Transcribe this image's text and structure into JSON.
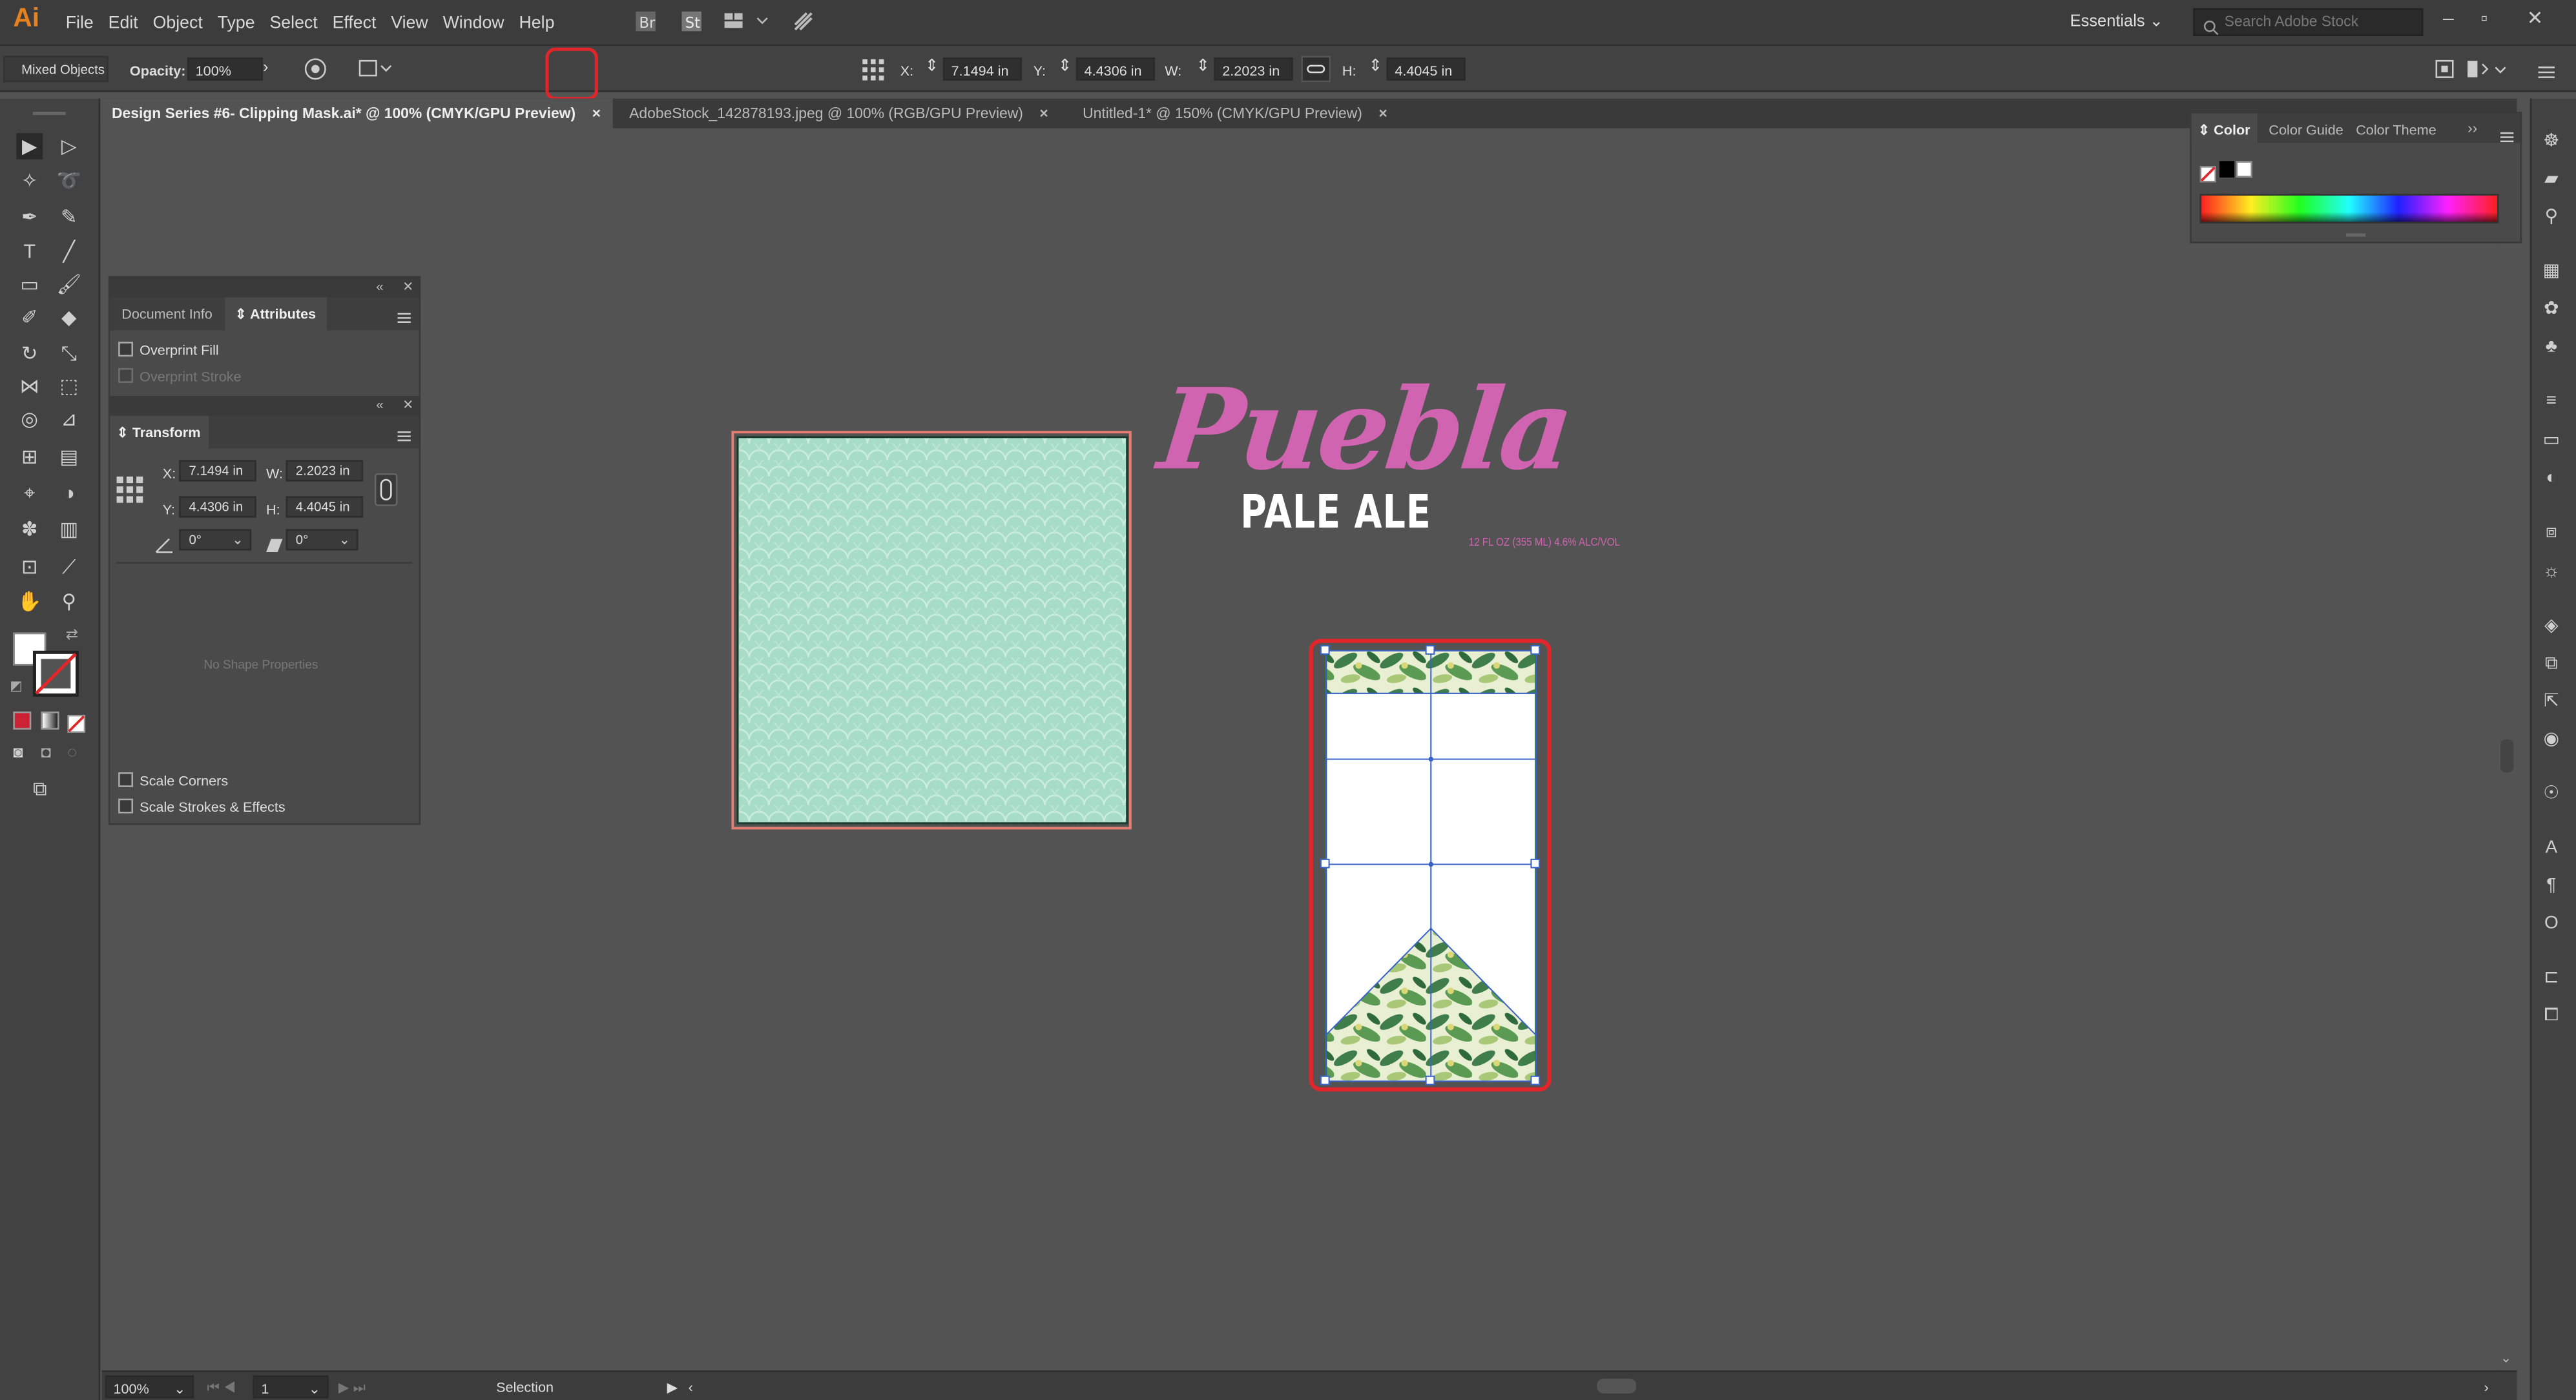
{
  "menu": {
    "logo": "Ai",
    "items": [
      "File",
      "Edit",
      "Object",
      "Type",
      "Select",
      "Effect",
      "View",
      "Window",
      "Help"
    ],
    "workspace": "Essentials",
    "search_placeholder": "Search Adobe Stock"
  },
  "control_bar": {
    "selection": "Mixed Objects",
    "opacity_label": "Opacity:",
    "opacity_value": "100%",
    "x_label": "X:",
    "x_value": "7.1494 in",
    "y_label": "Y:",
    "y_value": "4.4306 in",
    "w_label": "W:",
    "w_value": "2.2023 in",
    "h_label": "H:",
    "h_value": "4.4045 in"
  },
  "tabs": [
    {
      "label": "Design Series #6- Clipping Mask.ai* @ 100% (CMYK/GPU Preview)",
      "close": "×"
    },
    {
      "label": "AdobeStock_142878193.jpeg @ 100% (RGB/GPU Preview)",
      "close": "×"
    },
    {
      "label": "Untitled-1* @ 150% (CMYK/GPU Preview)",
      "close": "×"
    }
  ],
  "attributes_panel": {
    "tab1": "Document Info",
    "tab2": "Attributes",
    "overprint_fill": "Overprint Fill",
    "overprint_stroke": "Overprint Stroke"
  },
  "transform_panel": {
    "title": "Transform",
    "x_label": "X:",
    "x_value": "7.1494 in",
    "y_label": "Y:",
    "y_value": "4.4306 in",
    "w_label": "W:",
    "w_value": "2.2023 in",
    "h_label": "H:",
    "h_value": "4.4045 in",
    "angle_value": "0°",
    "shear_value": "0°",
    "no_shape": "No Shape Properties",
    "scale_corners": "Scale Corners",
    "scale_strokes": "Scale Strokes & Effects"
  },
  "color_panel": {
    "tab1": "Color",
    "tab2": "Color Guide",
    "tab3": "Color Theme"
  },
  "artwork": {
    "brand": "Puebla",
    "subtitle": "PALE ALE",
    "small_text": "12 FL OZ (355 ML) 4.6% ALC/VOL",
    "brand_color": "#d064b0",
    "pattern_color": "#a6dcc8"
  },
  "status_bar": {
    "zoom": "100%",
    "page": "1",
    "tool": "Selection"
  },
  "colors": {
    "highlight": "#e0252b",
    "selection": "#3a63c8"
  }
}
